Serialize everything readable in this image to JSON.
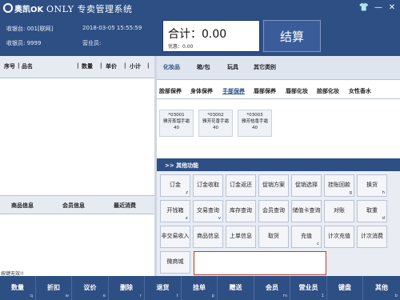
{
  "titlebar": {
    "logo_text": "奥凯OK",
    "title": "ONLY 专卖管理系统",
    "icons": [
      "shirt-icon",
      "minimize-icon",
      "close-icon"
    ]
  },
  "info": {
    "register": "收银台: 001[联网]",
    "datetime": "2018-03-05 15:55:59",
    "cashier": "收银员: 9999",
    "salesperson": "营业员:"
  },
  "totals": {
    "total_label": "合计：0.00",
    "discount_label": "优惠：0.00",
    "checkout_label": "结算"
  },
  "order_table": {
    "columns": [
      "序号",
      "品名",
      "数量",
      "单价",
      "小计"
    ]
  },
  "member_table": {
    "columns": [
      "商品信息",
      "会员信息",
      "最近消费"
    ]
  },
  "status_text": "按键无效!!",
  "category_tabs": [
    "化妆品",
    "箱/包",
    "玩具",
    "其它类别"
  ],
  "sub_tabs": [
    "脸部保养",
    "身体保养",
    "手部保养",
    "唇部保养",
    "唇部化妆",
    "脸部化妆",
    "女性香水"
  ],
  "products": [
    {
      "code": "*03001",
      "name": "雅芳蒸馏手霜",
      "price": "40"
    },
    {
      "code": "*03002",
      "name": "雅芳花香手霜",
      "price": "40"
    },
    {
      "code": "*03003",
      "name": "雅芳桔香手霜",
      "price": "40"
    }
  ],
  "functions": {
    "title": ">> 其他功能",
    "buttons": [
      {
        "label": "订金",
        "key": "z"
      },
      {
        "label": "订金收取",
        "key": ""
      },
      {
        "label": "订金返还",
        "key": ""
      },
      {
        "label": "促销方案",
        "key": ""
      },
      {
        "label": "促销选择",
        "key": ""
      },
      {
        "label": "挂账回款",
        "key": "g"
      },
      {
        "label": "换货",
        "key": "h"
      },
      {
        "label": "开钱箱",
        "key": "x"
      },
      {
        "label": "交易查询",
        "key": "v"
      },
      {
        "label": "库存查询",
        "key": ""
      },
      {
        "label": "会员查询",
        "key": ""
      },
      {
        "label": "储值卡查询",
        "key": ""
      },
      {
        "label": "对账",
        "key": ""
      },
      {
        "label": "取重",
        "key": "d"
      },
      {
        "label": "非交易收入",
        "key": ""
      },
      {
        "label": "商品信息",
        "key": ""
      },
      {
        "label": "上单信息",
        "key": ""
      },
      {
        "label": "取货",
        "key": ""
      },
      {
        "label": "充值",
        "key": "c"
      },
      {
        "label": "计次充值",
        "key": ""
      },
      {
        "label": "计次消费",
        "key": ""
      },
      {
        "label": "微商城",
        "key": ""
      }
    ]
  },
  "bottom_buttons": [
    {
      "label": "数量",
      "key": "q"
    },
    {
      "label": "折扣",
      "key": "w"
    },
    {
      "label": "议价",
      "key": "e"
    },
    {
      "label": "删除",
      "key": "r"
    },
    {
      "label": "退货",
      "key": "t"
    },
    {
      "label": "挂单",
      "key": "p"
    },
    {
      "label": "赠送",
      "key": ""
    },
    {
      "label": "会员",
      "key": "m"
    },
    {
      "label": "营业员",
      "key": "1"
    },
    {
      "label": "键盘",
      "key": ""
    },
    {
      "label": "其他",
      "key": "b"
    }
  ]
}
